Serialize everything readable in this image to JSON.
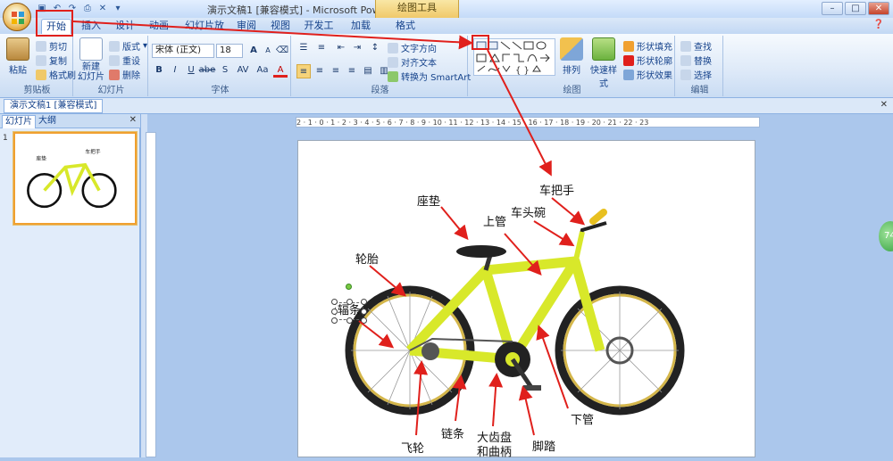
{
  "window": {
    "title": "演示文稿1 [兼容模式] - Microsoft PowerPoint",
    "context_tab": "绘图工具",
    "controls": [
      "–",
      "□",
      "×"
    ]
  },
  "quick_access": [
    "save-icon",
    "undo-icon",
    "redo-icon",
    "print-icon",
    "x-icon",
    "more-icon"
  ],
  "tabs": [
    "开始",
    "插入",
    "设计",
    "动画",
    "幻灯片放映",
    "审阅",
    "视图",
    "开发工具",
    "加载项",
    "格式"
  ],
  "active_tab": "开始",
  "help_icon": "help-icon",
  "ribbon": {
    "clipboard": {
      "label": "剪贴板",
      "paste": "粘贴",
      "cut": "剪切",
      "copy": "复制",
      "format_painter": "格式刷"
    },
    "slides": {
      "label": "幻灯片",
      "new_slide": "新建\n幻灯片",
      "layout": "版式",
      "reset": "重设",
      "delete": "删除"
    },
    "font": {
      "label": "字体",
      "font_name": "宋体 (正文)",
      "font_size": "18",
      "bold": "B",
      "italic": "I",
      "underline": "U",
      "strike": "abe",
      "shadow": "S",
      "spacing": "AV",
      "case": "Aa",
      "color": "A",
      "grow": "A",
      "shrink": "A"
    },
    "paragraph": {
      "label": "段落",
      "text_direction": "文字方向",
      "align_text": "对齐文本",
      "smartart": "转换为 SmartArt"
    },
    "drawing": {
      "label": "绘图",
      "arrange": "排列",
      "quick_styles": "快速样式",
      "shape_fill": "形状填充",
      "shape_outline": "形状轮廓",
      "shape_effects": "形状效果"
    },
    "editing": {
      "label": "编辑",
      "find": "查找",
      "replace": "替换",
      "select": "选择"
    }
  },
  "document_tab": "演示文稿1 [兼容模式]",
  "left_pane": {
    "tabs": [
      "幻灯片",
      "大纲"
    ],
    "slide_number": "1"
  },
  "ruler": {
    "h_ticks": "2 · 1 · 0 · 1 · 2 · 3 · 4 · 5 · 6 · 7 · 8 · 9 · 10 · 11 · 12 · 13 · 14 · 15 · 16 · 17 · 18 · 19 · 20 · 21 · 22 · 23"
  },
  "slide": {
    "labels": {
      "handlebar": "车把手",
      "seat": "座垫",
      "top_tube": "上管",
      "head_tube": "车头碗",
      "tire": "轮胎",
      "spoke": "辐条",
      "down_tube": "下管",
      "freewheel": "飞轮",
      "chain": "链条",
      "chainring": "大齿盘",
      "crank": "和曲柄",
      "pedal": "脚踏"
    }
  },
  "badge": "74",
  "colors": {
    "accent_red": "#e0201c",
    "bike_yellow": "#d8e82a",
    "ribbon_blue": "#dbe8f8"
  }
}
